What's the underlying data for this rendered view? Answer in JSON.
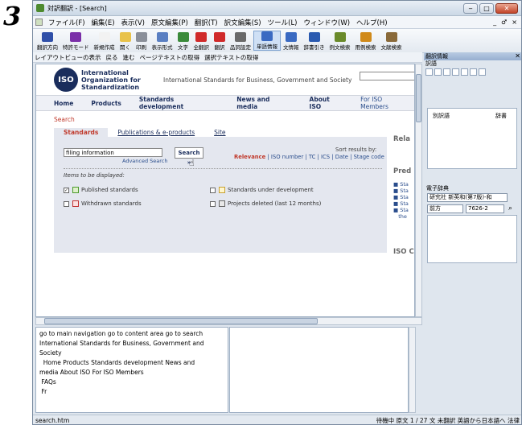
{
  "step_number": "3",
  "window": {
    "title": "対訳翻訳 - [Search]",
    "controls": {
      "minimize": "‒",
      "maximize": "□",
      "close": "✕"
    }
  },
  "menu": {
    "items": [
      "ファイル(F)",
      "編集(E)",
      "表示(V)",
      "原文編集(P)",
      "翻訳(T)",
      "訳文編集(S)",
      "ツール(L)",
      "ウィンドウ(W)",
      "ヘルプ(H)"
    ],
    "right_controls": [
      "_",
      "♂",
      "×"
    ]
  },
  "toolbar": {
    "buttons": [
      {
        "label": "翻訳方向",
        "icon": "direction-icon",
        "color": "#2f4fa8"
      },
      {
        "label": "特許モード",
        "icon": "patent-mode-icon",
        "color": "#7a2fa8"
      },
      {
        "label": "新規作成",
        "icon": "new-file-icon",
        "color": "#f2f2f2"
      },
      {
        "label": "開く",
        "icon": "open-folder-icon",
        "color": "#e8c24a"
      },
      {
        "label": "印刷",
        "icon": "print-icon",
        "color": "#8a8f99"
      },
      {
        "label": "表示形式",
        "icon": "display-format-icon",
        "color": "#5a7fc2"
      },
      {
        "label": "文字",
        "icon": "font-icon",
        "color": "#3a8a3a"
      },
      {
        "label": "全翻訳",
        "icon": "translate-all-icon",
        "color": "#d02a2a"
      },
      {
        "label": "翻訳",
        "icon": "translate-icon",
        "color": "#d02a2a"
      },
      {
        "label": "品詞設定",
        "icon": "pos-setting-icon",
        "color": "#6a6a6a"
      },
      {
        "label": "単語情報",
        "icon": "word-info-icon",
        "color": "#3a6ac2",
        "active": true
      },
      {
        "label": "文情報",
        "icon": "sentence-info-icon",
        "color": "#3a6ac2"
      },
      {
        "label": "辞書引き",
        "icon": "dictionary-lookup-icon",
        "color": "#2a5ab0"
      },
      {
        "label": "例文検索",
        "icon": "example-search-icon",
        "color": "#6a8a2a"
      },
      {
        "label": "用例検索",
        "icon": "usage-search-icon",
        "color": "#d08a1a"
      },
      {
        "label": "文献検索",
        "icon": "document-search-icon",
        "color": "#8a6a3a"
      }
    ]
  },
  "navbar": {
    "items": [
      "レイアウトビューの表示",
      "戻る",
      "進む",
      "ページテキストの取得",
      "選択テキストの取得"
    ]
  },
  "iso_page": {
    "org_name_lines": [
      "International",
      "Organization for",
      "Standardization"
    ],
    "logo_text": "ISO",
    "tagline": "International Standards for Business, Government and Society",
    "nav": [
      "Home",
      "Products",
      "Standards development",
      "News and media",
      "About ISO"
    ],
    "members_link": "For ISO Members",
    "breadcrumb": "Search",
    "tabs": [
      "Standards",
      "Publications & e-products",
      "Site"
    ],
    "search_value": "filing information",
    "advanced_search": "Advanced Search",
    "search_button": "Search",
    "sort_by_label": "Sort results by:",
    "sort_links": [
      "Relevance",
      "ISO number",
      "TC",
      "ICS",
      "Date",
      "Stage code"
    ],
    "items_label": "Items to be displayed:",
    "options": [
      {
        "label": "Published standards",
        "checked": true
      },
      {
        "label": "Standards under development",
        "checked": false
      },
      {
        "label": "Withdrawn standards",
        "checked": false
      },
      {
        "label": "Projects deleted (last 12 months)",
        "checked": false
      }
    ],
    "right_headings": [
      "Rela",
      "Pred",
      "ISO C"
    ],
    "right_links": [
      "Sta",
      "Sta",
      "Sta",
      "Sta",
      "Sta",
      "the"
    ]
  },
  "text_pane": {
    "lines": [
      "go to main navigation go to content area go to search",
      "International Standards for Business, Government and",
      "Society",
      "  Home Products Standards development News and",
      "media About ISO For ISO Members",
      " FAQs",
      " Fr"
    ]
  },
  "status": {
    "left": "search.htm",
    "right": "待機中  原文  1 / 27 文  未翻訳  英語から日本語へ  法律"
  },
  "right_panel": {
    "title": "翻訳情報",
    "subtitle": "訳語",
    "columns": [
      "別訳語",
      "辞書"
    ],
    "dict_title": "電子辞典",
    "dict_select": "研究社 新英和(第7版)-和",
    "match_select": "前方",
    "code_select": "7626-2"
  }
}
